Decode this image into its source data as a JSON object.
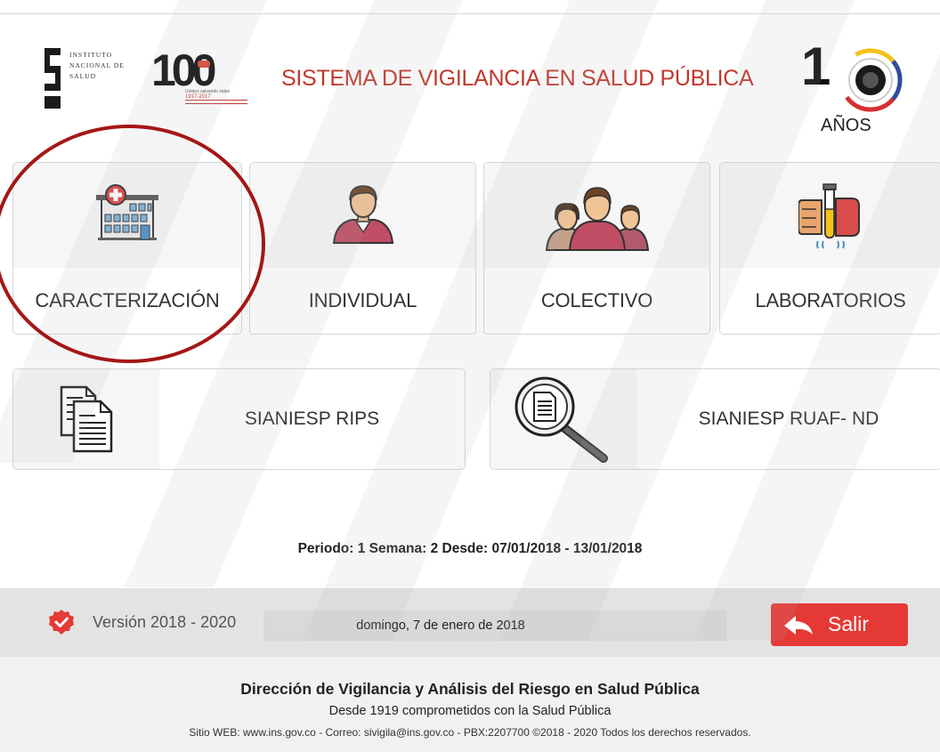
{
  "header": {
    "institute_name": [
      "Instituto",
      "Nacional de",
      "Salud"
    ],
    "centennial_logo": {
      "number": "100",
      "tagline": "Unidos salvando vidas",
      "years": "1917-2017"
    },
    "system_title": "SISTEMA DE VIGILANCIA EN SALUD PÚBLICA",
    "anniversary_logo": {
      "number": "1",
      "label": "AÑOS"
    }
  },
  "tiles": [
    {
      "label": "CARACTERIZACIÓN",
      "icon": "hospital-icon"
    },
    {
      "label": "INDIVIDUAL",
      "icon": "person-icon"
    },
    {
      "label": "COLECTIVO",
      "icon": "group-icon"
    },
    {
      "label": "LABORATORIOS",
      "icon": "test-tube-icon"
    }
  ],
  "wide_tiles": [
    {
      "label": "SIANIESP RIPS",
      "icon": "documents-icon"
    },
    {
      "label": "SIANIESP RUAF- ND",
      "icon": "magnifier-document-icon"
    }
  ],
  "period_text": "Periodo: 1 Semana: 2 Desde: 07/01/2018 - 13/01/2018",
  "status_bar": {
    "version": "Versión 2018 - 2020",
    "date": "domingo, 7 de enero de 2018",
    "exit_label": "Salir"
  },
  "footer": {
    "title": "Dirección de Vigilancia y Análisis del Riesgo en Salud Pública",
    "subtitle": "Desde 1919  comprometidos con la Salud Pública",
    "contact": "Sitio WEB: www.ins.gov.co - Correo: sivigila@ins.gov.co - PBX:2207700   ©2018 - 2020 Todos los derechos reservados."
  },
  "colors": {
    "accent_red": "#c0392b",
    "button_red": "#e53935",
    "highlight_circle": "#a51616"
  }
}
